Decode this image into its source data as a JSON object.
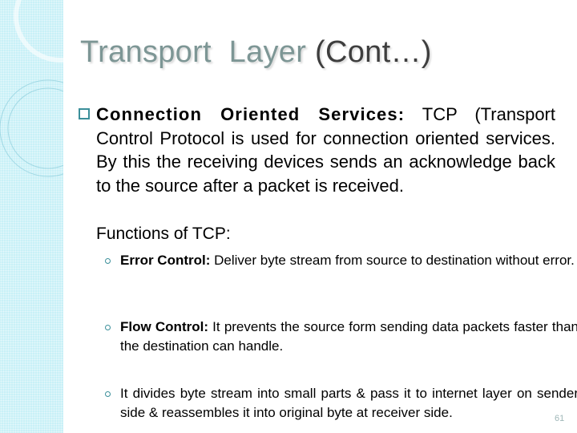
{
  "slide": {
    "title_part1": "Transport  Layer ",
    "title_part2": "(Cont…)",
    "main_bullet": {
      "bold_label": "Connection Oriented Services:",
      "text": " TCP (Transport Control Protocol is used for connection oriented services. By this the receiving devices sends an acknowledge back to the source after a packet is received."
    },
    "functions_heading": "Functions of TCP:",
    "sub_bullets": [
      {
        "bold_label": "Error Control:",
        "text": " Deliver byte stream from source to destination without error."
      },
      {
        "bold_label": "Flow Control:",
        "text": " It prevents the source form sending data packets faster than the destination can handle."
      },
      {
        "bold_label": "",
        "text": "It divides byte stream into small parts & pass it to internet layer on sender side & reassembles it into original byte at receiver side."
      }
    ],
    "page_number": "61"
  },
  "colors": {
    "title_primary": "#7d9695",
    "title_secondary": "#3e3e3e",
    "accent": "#3b8f9a",
    "strip": "#c8f0f7"
  }
}
